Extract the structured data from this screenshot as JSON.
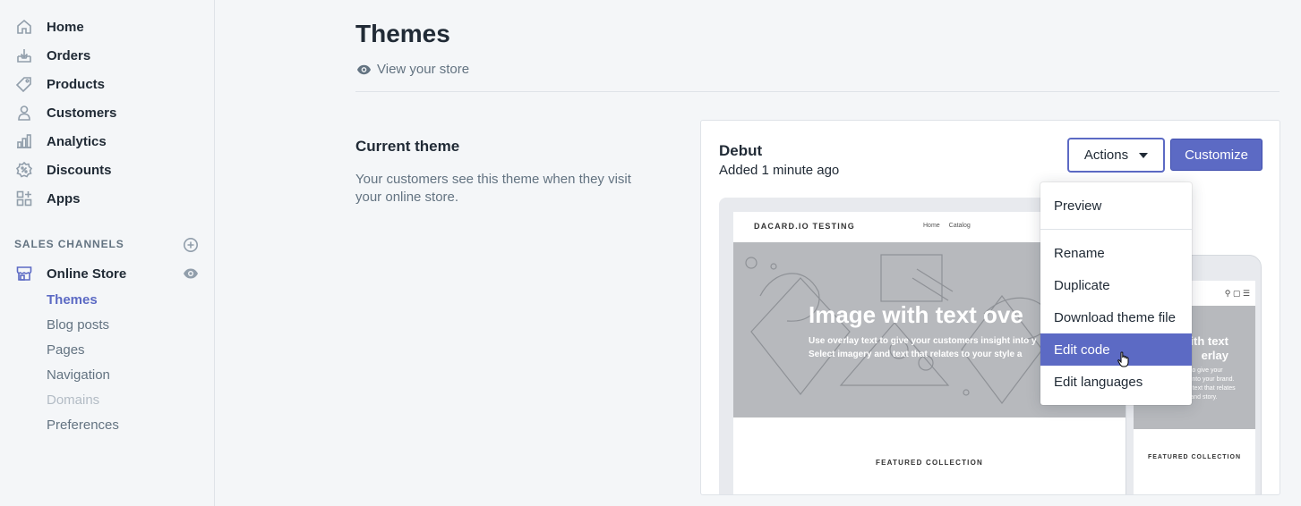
{
  "sidebar": {
    "nav": [
      {
        "label": "Home",
        "icon": "home-icon"
      },
      {
        "label": "Orders",
        "icon": "orders-icon"
      },
      {
        "label": "Products",
        "icon": "tag-icon"
      },
      {
        "label": "Customers",
        "icon": "person-icon"
      },
      {
        "label": "Analytics",
        "icon": "bar-chart-icon"
      },
      {
        "label": "Discounts",
        "icon": "discount-icon"
      },
      {
        "label": "Apps",
        "icon": "apps-icon"
      }
    ],
    "sales_channels_title": "SALES CHANNELS",
    "online_store": {
      "label": "Online Store",
      "icon": "store-icon"
    },
    "sub_items": [
      {
        "label": "Themes",
        "state": "active"
      },
      {
        "label": "Blog posts",
        "state": "normal"
      },
      {
        "label": "Pages",
        "state": "normal"
      },
      {
        "label": "Navigation",
        "state": "normal"
      },
      {
        "label": "Domains",
        "state": "disabled"
      },
      {
        "label": "Preferences",
        "state": "normal"
      }
    ]
  },
  "main": {
    "title": "Themes",
    "view_store": "View your store",
    "section_title": "Current theme",
    "section_description": "Your customers see this theme when they visit your online store."
  },
  "theme": {
    "name": "Debut",
    "added": "Added 1 minute ago",
    "actions_label": "Actions",
    "customize_label": "Customize",
    "preview": {
      "store_name": "DACARD.IO TESTING",
      "nav_home": "Home",
      "nav_catalog": "Catalog",
      "hero_title": "Image with text ove",
      "hero_line1": "Use overlay text to give your customers insight into y",
      "hero_line2": "Select imagery and text that relates to your style a",
      "featured": "FEATURED COLLECTION",
      "mobile_hero_title": "with text\nerlay",
      "mobile_hero_sub": "xt to give your\nht into your brand.\nnd text that relates\nle and story.",
      "mobile_featured": "FEATURED COLLECTION"
    }
  },
  "actions_menu": {
    "items": [
      "Preview",
      "Rename",
      "Duplicate",
      "Download theme file",
      "Edit code",
      "Edit languages"
    ],
    "highlighted": "Edit code"
  },
  "colors": {
    "accent": "#5c6ac4",
    "sidebar_bg": "#f4f6f8",
    "text": "#212b36",
    "muted": "#637381"
  }
}
